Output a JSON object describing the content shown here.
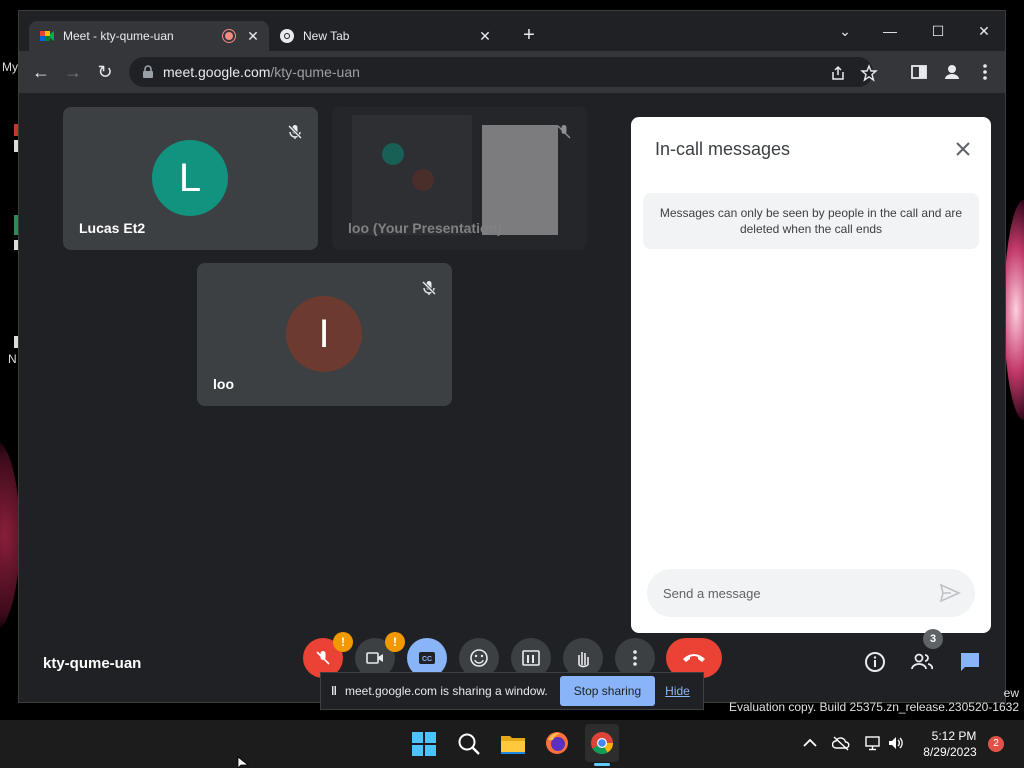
{
  "desktop": {
    "left_strip_texts": [
      "My",
      "N"
    ]
  },
  "browser": {
    "tabs": [
      {
        "title": "Meet - kty-qume-uan",
        "recording": true,
        "active": true
      },
      {
        "title": "New Tab",
        "active": false
      }
    ],
    "url_host": "meet.google.com",
    "url_path": "/kty-qume-uan"
  },
  "meet": {
    "participants": [
      {
        "name": "Lucas Et2",
        "initial": "L",
        "avatar_color": "#12937f",
        "muted": true
      },
      {
        "name": "loo (Your Presentation)",
        "initial": "",
        "muted": true
      },
      {
        "name": "loo",
        "initial": "I",
        "avatar_color": "#6d3a2f",
        "muted": true
      }
    ],
    "panel": {
      "title": "In-call messages",
      "notice": "Messages can only be seen by people in the call and are deleted when the call ends",
      "input_placeholder": "Send a message"
    },
    "meeting_code": "kty-qume-uan",
    "people_count": "3",
    "warn_badge": "!",
    "share_bar": {
      "text": "meet.google.com is sharing a window.",
      "stop_label": "Stop sharing",
      "hide_label": "Hide"
    },
    "accent_color": "#8ab4f8",
    "end_call_color": "#ea4335"
  },
  "watermark": {
    "edge_text": "ew",
    "evaluation": "Evaluation copy. Build 25375.zn_release.230520-1632"
  },
  "taskbar": {
    "time": "5:12 PM",
    "date": "8/29/2023",
    "notification_count": "2",
    "apps": [
      "windows-start-icon",
      "search-icon",
      "file-explorer-icon",
      "firefox-icon",
      "chrome-icon"
    ]
  }
}
